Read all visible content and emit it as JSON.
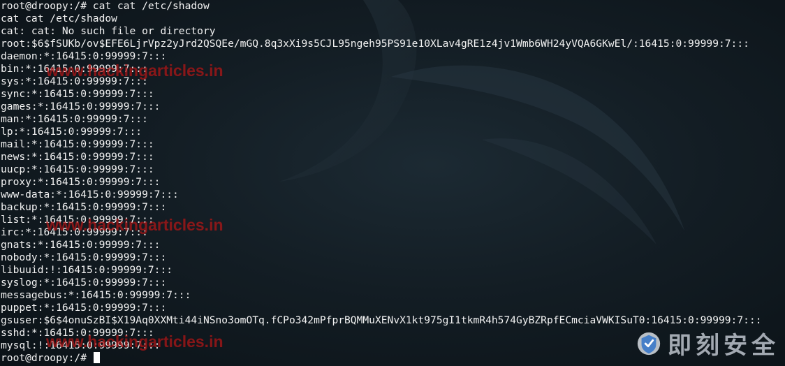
{
  "terminal": {
    "lines": [
      "root@droopy:/# cat cat /etc/shadow",
      "cat cat /etc/shadow",
      "cat: cat: No such file or directory",
      "root:$6$fSUKb/ov$EFE6LjrVpz2yJrd2QSQEe/mGQ.8q3xXi9s5CJL95ngeh95PS91e10XLav4gRE1z4jv1Wmb6WH24yVQA6GKwEl/:16415:0:99999:7:::",
      "daemon:*:16415:0:99999:7:::",
      "bin:*:16415:0:99999:7:::",
      "sys:*:16415:0:99999:7:::",
      "sync:*:16415:0:99999:7:::",
      "games:*:16415:0:99999:7:::",
      "man:*:16415:0:99999:7:::",
      "lp:*:16415:0:99999:7:::",
      "mail:*:16415:0:99999:7:::",
      "news:*:16415:0:99999:7:::",
      "uucp:*:16415:0:99999:7:::",
      "proxy:*:16415:0:99999:7:::",
      "www-data:*:16415:0:99999:7:::",
      "backup:*:16415:0:99999:7:::",
      "list:*:16415:0:99999:7:::",
      "irc:*:16415:0:99999:7:::",
      "gnats:*:16415:0:99999:7:::",
      "nobody:*:16415:0:99999:7:::",
      "libuuid:!:16415:0:99999:7:::",
      "syslog:*:16415:0:99999:7:::",
      "messagebus:*:16415:0:99999:7:::",
      "puppet:*:16415:0:99999:7:::",
      "gsuser:$6$4onuSzBI$X19Aq0XXMti44iNSno3omOTq.fCPo342mPfprBQMMuXENvX1kt975gI1tkmR4h574GyBZRpfECmciaVWKISuT0:16415:0:99999:7:::",
      "sshd:*:16415:0:99999:7:::",
      "mysql:!:16415:0:99999:7:::"
    ],
    "prompt": "root@droopy:/# "
  },
  "watermark": {
    "text_1": "www.hackingarticles.in",
    "text_2": "www.hackingarticles.in",
    "text_3": "www.hackingarticles.in"
  },
  "brand": {
    "text": "即刻安全",
    "logo_icon": "shield-logo-icon"
  },
  "colors": {
    "text": "#f2f2f2",
    "background": "#131d24",
    "watermark": "#c81e1e"
  }
}
